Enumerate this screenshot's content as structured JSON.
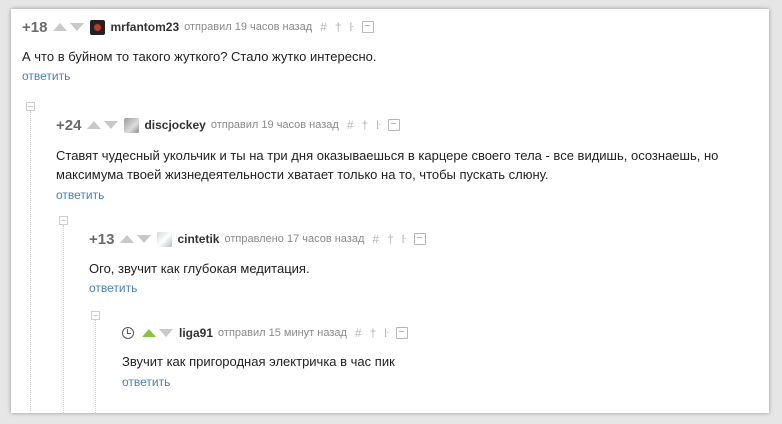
{
  "comments": [
    {
      "rating": "+18",
      "username": "mrfantom23",
      "meta": "отправил 19 часов назад",
      "text": "А что в буйном то такого жуткого? Стало жутко интересно.",
      "reply": "ответить",
      "avatar": "dark-avatar"
    },
    {
      "rating": "+24",
      "username": "discjockey",
      "meta": "отправил 19 часов назад",
      "text_lines": [
        "Ставят чудесный укольчик и ты на три дня оказываешься в карцере своего тела - все видишь, осознаешь, но",
        "максимума твоей жизнедеятельности хватает только на то, чтобы пускать слюну."
      ],
      "reply": "ответить",
      "avatar": "gray-avatar"
    },
    {
      "rating": "+13",
      "username": "cintetik",
      "meta": "отправлено 17 часов назад",
      "text": "Ого, звучит как глубокая медитация.",
      "reply": "ответить",
      "avatar": "light-avatar"
    },
    {
      "rating": "",
      "username": "liga91",
      "meta": "отправил 15 минут назад",
      "text": "Звучит как пригородная электричка в час пик",
      "reply": "ответить",
      "icon": "clock-icon"
    }
  ],
  "toolbar_icons": [
    "hash-icon",
    "pin-icon",
    "branch-icon",
    "save-icon"
  ],
  "toolbar_glyphs": {
    "hash": "#",
    "pin": "†",
    "branch": "ŀ"
  },
  "colors": {
    "link": "#4a7fb5",
    "vote_active": "#8ac43f",
    "vote_inactive": "#c9c9c9"
  }
}
